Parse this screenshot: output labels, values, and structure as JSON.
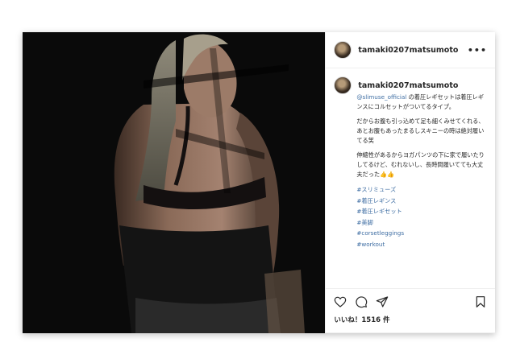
{
  "post": {
    "username": "tamaki0207matsumoto",
    "more_icon": "ellipsis-icon"
  },
  "caption": {
    "username": "tamaki0207matsumoto",
    "mention": "@slimuse_official",
    "line1_rest": " の着圧レギセットは着圧レギンスにコルセットがついてるタイプ。",
    "para2": "だからお腹も引っ込めて足も細くみせてくれる、あとお腹もあったまるしスキニーの時は絶対履いてる笑",
    "para3": "伸縮性があるからヨガパンツの下に家で履いたりしてるけど、むれないし、長時間履いてても大丈夫だった👍👍",
    "tags": [
      "#スリミューズ",
      "#着圧レギンス",
      "#着圧レギセット",
      "#美脚",
      "#corsetleggings",
      "#workout"
    ]
  },
  "actions": {
    "like_icon": "heart-icon",
    "comment_icon": "comment-icon",
    "share_icon": "send-icon",
    "save_icon": "bookmark-icon",
    "likes_text": "いいね！1516 件"
  }
}
